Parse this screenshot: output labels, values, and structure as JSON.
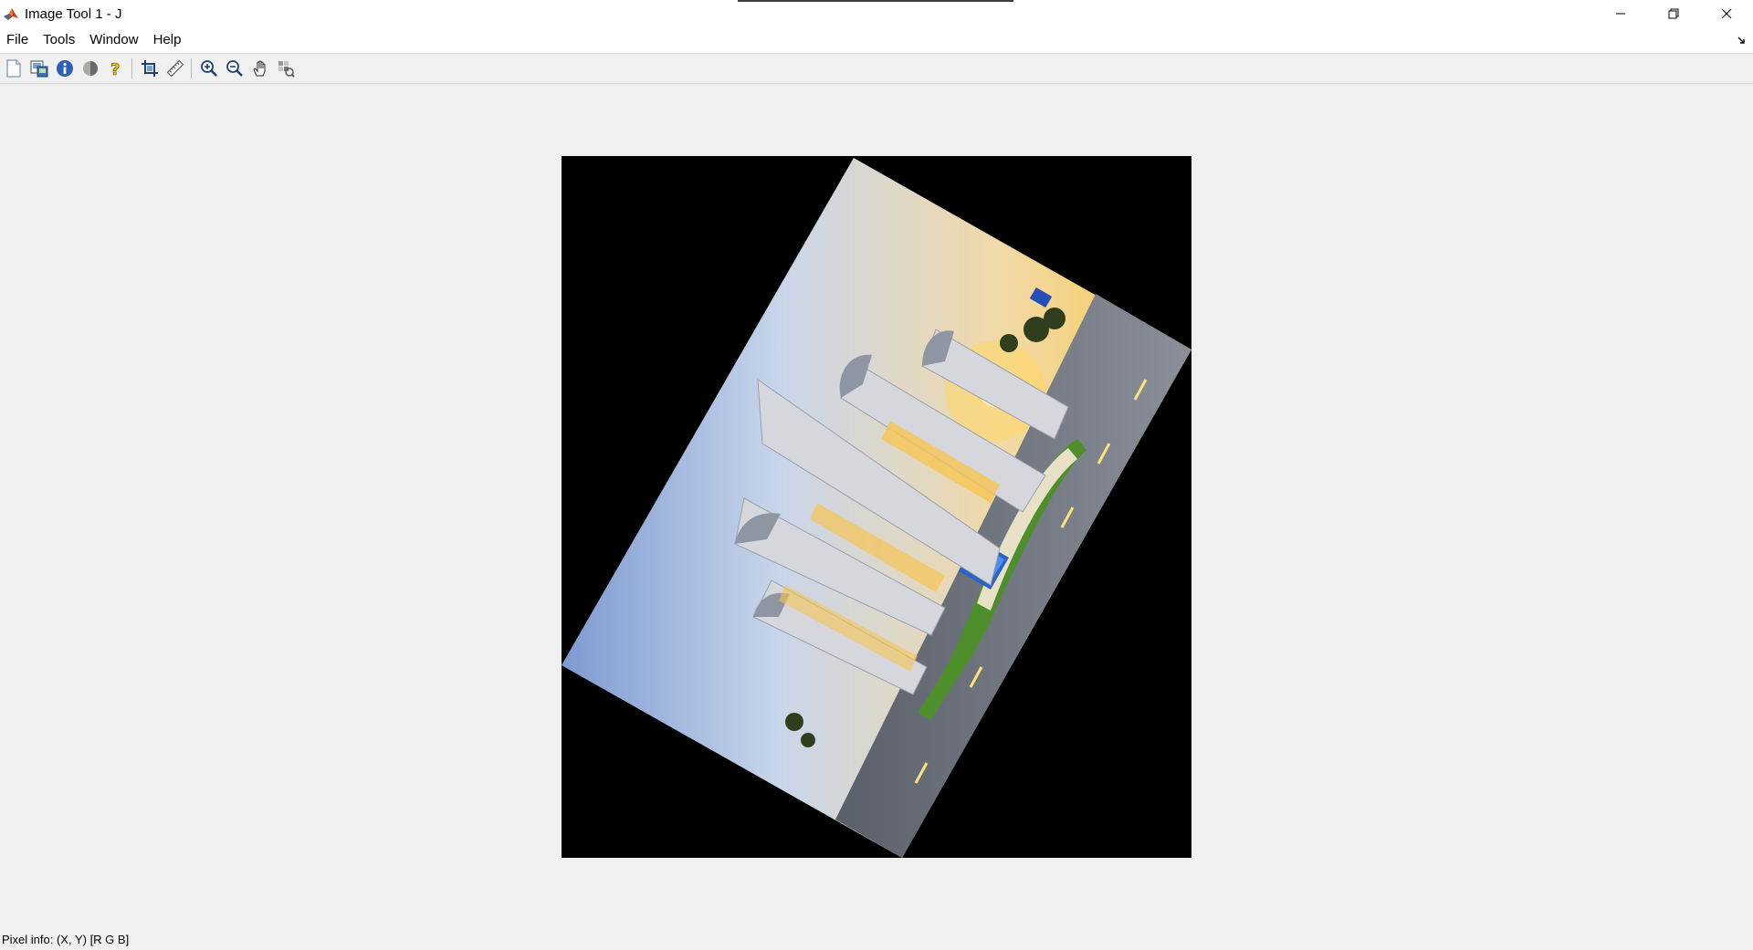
{
  "window": {
    "title": "Image Tool 1 - J",
    "controls": [
      "minimize-icon",
      "restore-icon",
      "close-icon"
    ]
  },
  "menu": {
    "items": [
      "File",
      "Tools",
      "Window",
      "Help"
    ]
  },
  "toolbar": {
    "buttons": [
      "new-figure-icon",
      "export-image-icon",
      "image-information-icon",
      "adjust-contrast-icon",
      "help-icon",
      "crop-image-icon",
      "measure-distance-icon",
      "zoom-in-icon",
      "zoom-out-icon",
      "pan-icon",
      "pixel-region-icon"
    ]
  },
  "status": {
    "pixel_info": "Pixel info: (X, Y)  [R G B]"
  },
  "colors": {
    "background": "#f0f0f0",
    "image_background": "#000000",
    "titlebar": "#ffffff"
  }
}
